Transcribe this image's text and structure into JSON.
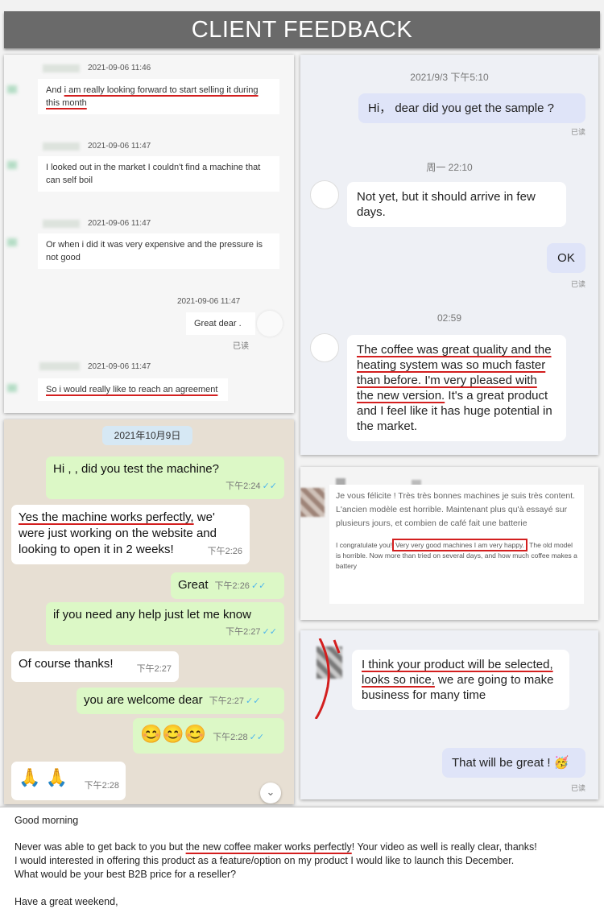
{
  "banner": {
    "title": "CLIENT FEEDBACK"
  },
  "chat1": {
    "messages": [
      {
        "time": "2021-09-06 11:46",
        "text_pre": "And ",
        "text_ul": "i am really looking forward to start selling it during this month"
      },
      {
        "time": "2021-09-06 11:47",
        "text": "I looked out in the market I couldn't find a machine that can self boil"
      },
      {
        "time": "2021-09-06 11:47",
        "text": "Or when i did it was very expensive and the pressure is not good"
      },
      {
        "time": "2021-09-06 11:47",
        "text": "Great dear .",
        "read": "已读"
      },
      {
        "time": "2021-09-06 11:47",
        "text_ul": "So i would really like to reach an agreement"
      }
    ],
    "blurred_name": "Ca..."
  },
  "chat2": {
    "t1": "2021/9/3 下午5:10",
    "m1": "Hi， dear  did you get the sample ?",
    "read1": "已读",
    "t2": "周一 22:10",
    "m2": "Not yet, but it should arrive in few days.",
    "m3": "OK",
    "read2": "已读",
    "t3": "02:59",
    "m4_ul": "The coffee was great quality and the heating system was so much faster than before. I'm very pleased with the new version.",
    "m4_rest": " It's a great product and I feel like it has huge potential in the market."
  },
  "chat3": {
    "date": "2021年10月9日",
    "m1": "Hi , , did you test the machine?",
    "m1_time": "下午2:24",
    "m2_ul": "Yes the machine works perfectly,",
    "m2_rest": " we' were just working on the website and looking to open it in 2 weeks!",
    "m2_time": "下午2:26",
    "m3": "Great",
    "m3_time": "下午2:26",
    "m4": "if you need any help just let me know",
    "m4_time": "下午2:27",
    "m5": "Of course thanks!",
    "m5_time": "下午2:27",
    "m6": "you are welcome dear",
    "m6_time": "下午2:27",
    "m7": "😊😊😊",
    "m7_time": "下午2:28",
    "m8": "🙏 🙏",
    "m8_time": "下午2:28",
    "tick": "✓✓",
    "scroll_icon": "double-chevron-down"
  },
  "review": {
    "fr": "Je vous félicite ! Très très bonnes machines je suis très content. L'ancien modèle est horrible. Maintenant plus qu'à essayé sur plusieurs jours, et combien de café fait une batterie",
    "en_pre": "I congratulate you!",
    "en_box": "Very very good machines I am very happy.",
    "en_post": " The old model is horrible. Now more than tried on several days, and how much coffee makes a battery"
  },
  "chat5": {
    "m1_ul": "I think your product will be selected, looks so nice,",
    "m1_rest": " we are going to make business for many time",
    "m2": "That will be great ! 🥳",
    "read": "已读"
  },
  "email": {
    "greeting": "Good morning",
    "p1_pre": "Never was able to get back to you but ",
    "p1_ul": "the new coffee maker works perfectly",
    "p1_post": "! Your video as well is really clear, thanks!",
    "p2": " I would interested in offering this product as a feature/option on my product I would like to launch this December.",
    "p3": "What would be your best B2B price for a reseller?",
    "closing": "Have a great weekend,"
  },
  "colors": {
    "underline": "#d31f1f",
    "wa_out": "#dcf8c6",
    "tick": "#4fb6ec"
  }
}
